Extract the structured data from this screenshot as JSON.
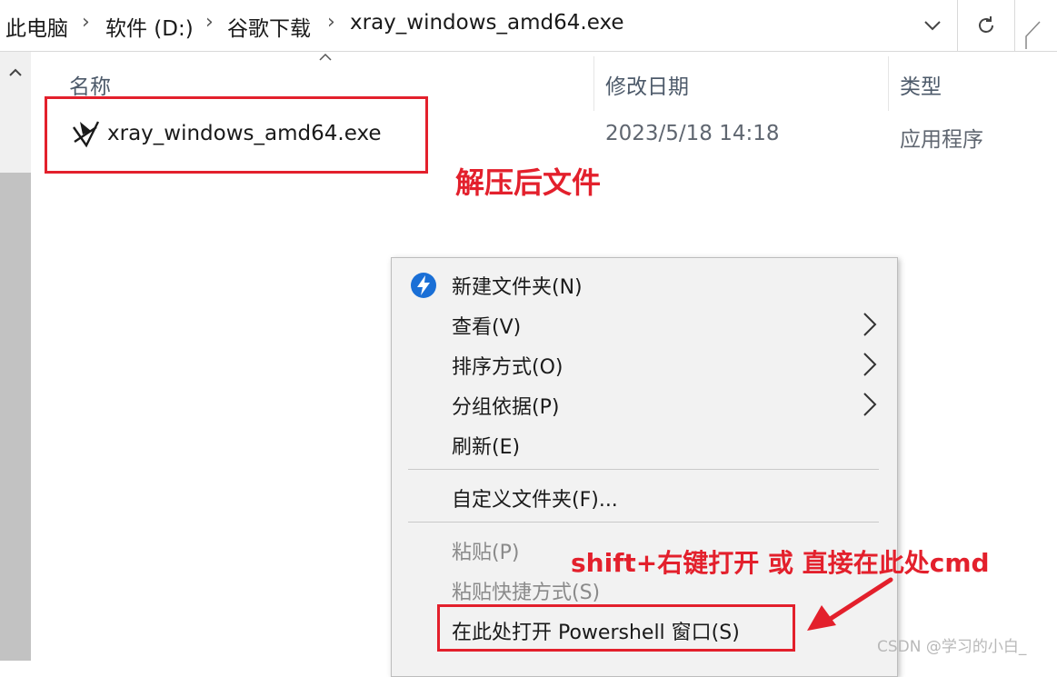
{
  "address_bar": {
    "crumbs": [
      "此电脑",
      "软件 (D:)",
      "谷歌下载",
      "xray_windows_amd64.exe"
    ]
  },
  "columns": {
    "name": "名称",
    "modified": "修改日期",
    "type": "类型"
  },
  "file": {
    "name": "xray_windows_amd64.exe",
    "modified": "2023/5/18 14:18",
    "type": "应用程序"
  },
  "annotations": {
    "extracted_file": "解压后文件",
    "open_hint": "shift+右键打开 或 直接在此处cmd"
  },
  "context_menu": {
    "items": [
      {
        "label": "新建文件夹(N)"
      },
      {
        "label": "查看(V)"
      },
      {
        "label": "排序方式(O)"
      },
      {
        "label": "分组依据(P)"
      },
      {
        "label": "刷新(E)"
      },
      {
        "label": "自定义文件夹(F)..."
      },
      {
        "label": "粘贴(P)"
      },
      {
        "label": "粘贴快捷方式(S)"
      },
      {
        "label": "在此处打开 Powershell 窗口(S)"
      }
    ]
  },
  "icons": {
    "new_folder": "new-folder-icon",
    "submenu_arrow": "chevron-right-icon",
    "exe": "application-icon"
  },
  "colors": {
    "annotation_red": "#e3202c",
    "new_folder_blue": "#1a6fd6"
  },
  "watermark": "CSDN @学习的小白_"
}
